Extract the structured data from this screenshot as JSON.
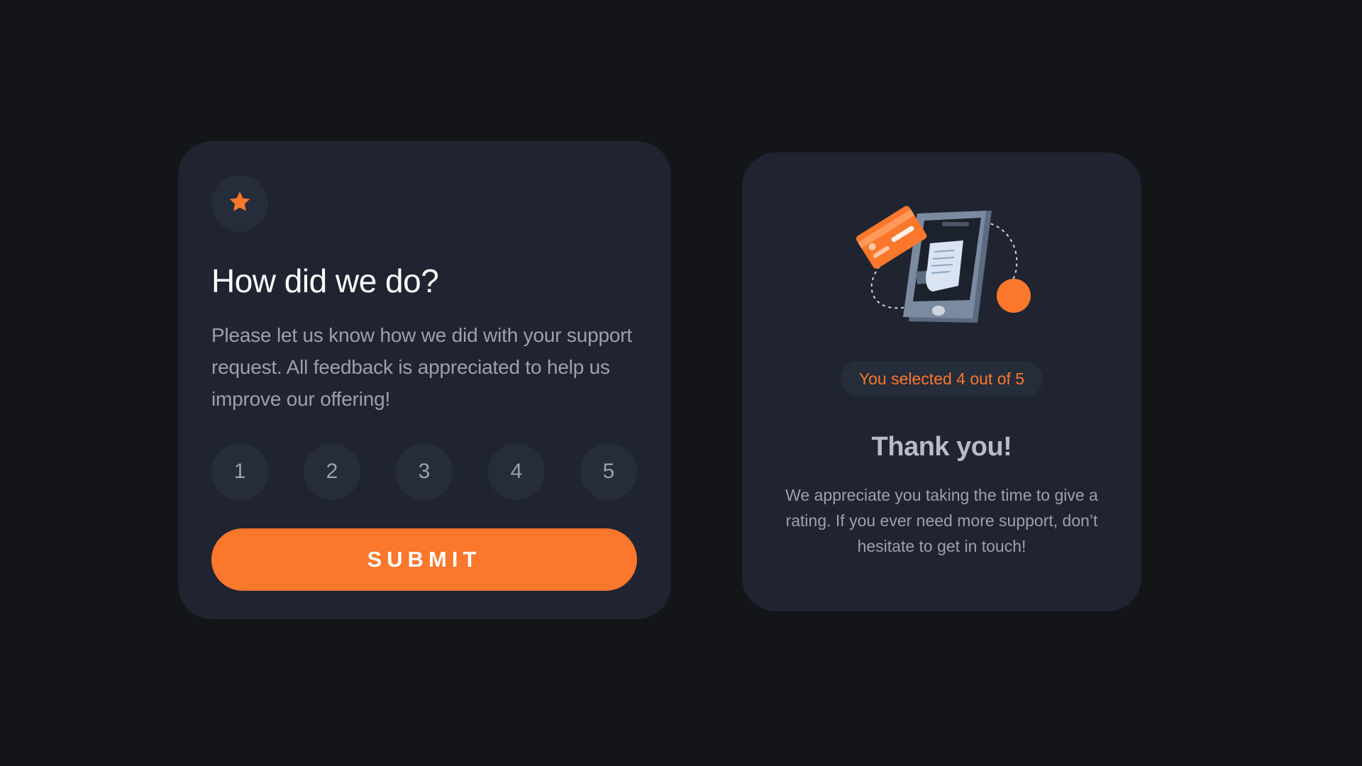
{
  "rating_card": {
    "icon": "star-icon",
    "title": "How did we do?",
    "description": "Please let us know how we did with your support request. All feedback is appreciated to help us improve our offering!",
    "options": [
      "1",
      "2",
      "3",
      "4",
      "5"
    ],
    "submit_label": "SUBMIT"
  },
  "thanks_card": {
    "illustration": "phone-payment-illustration",
    "selected_text": "You selected 4 out of 5",
    "title": "Thank you!",
    "description": "We appreciate you taking the time to give a rating. If you ever need more support, don’t hesitate to get in touch!"
  },
  "colors": {
    "background": "#131518",
    "card": "#1f2430",
    "chip": "#262d3a",
    "accent": "#fa772c",
    "muted_text": "#9aa1ad",
    "title_text": "#ffffff"
  }
}
